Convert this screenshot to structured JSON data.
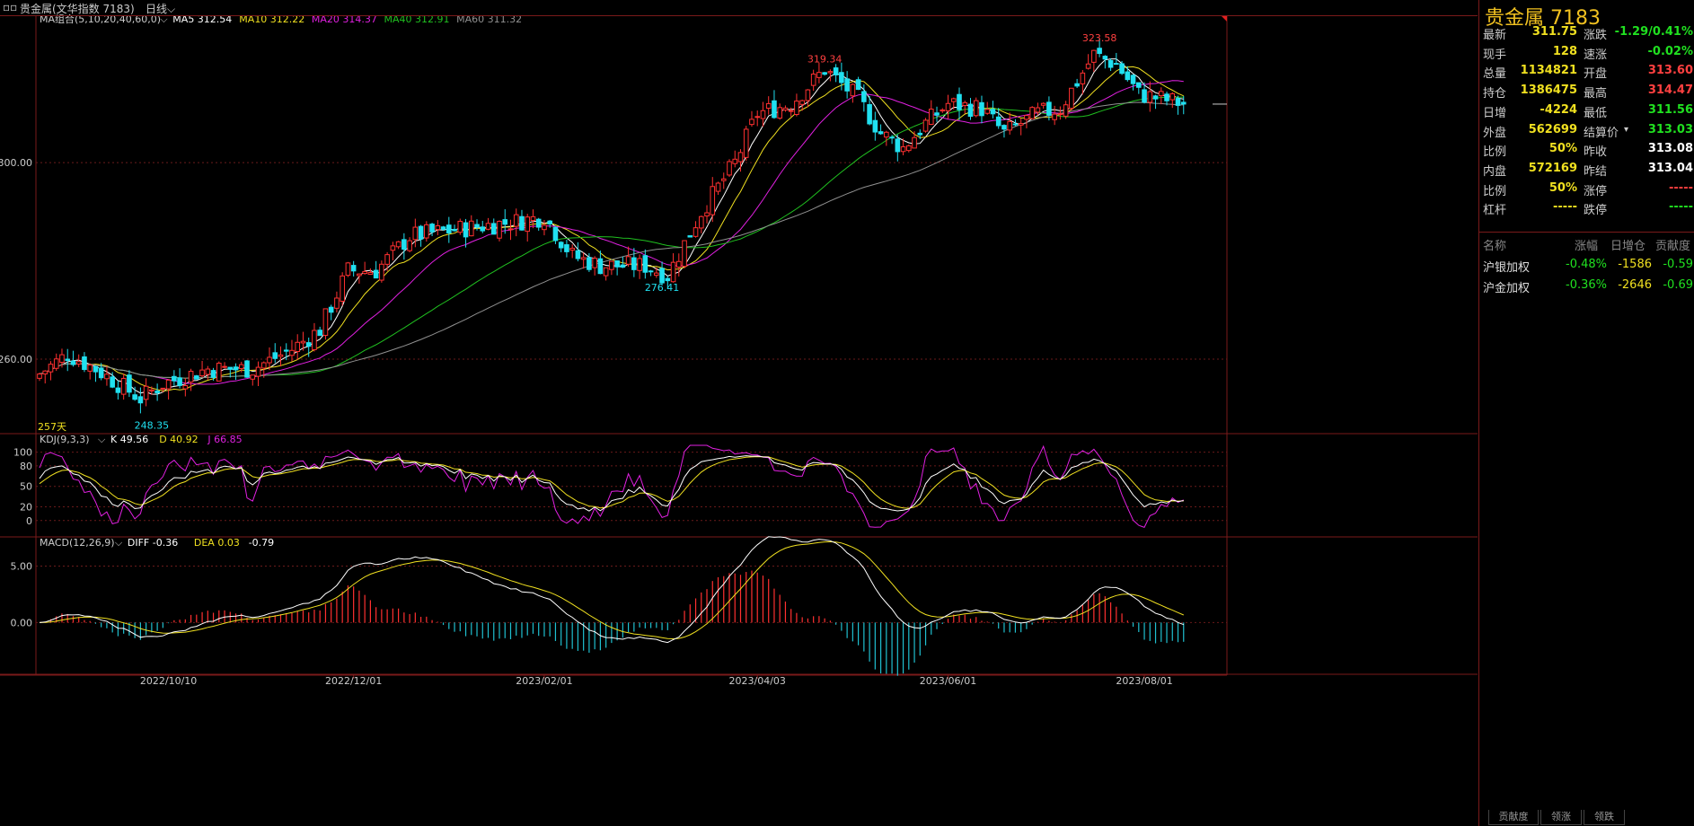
{
  "titlebar": {
    "name": "贵金属(文华指数 7183)",
    "period": "日线"
  },
  "indicators": {
    "ma": {
      "label": "MA组合(5,10,20,40,60,0)",
      "items": [
        {
          "text": "MA5 312.54",
          "color": "#ffffff"
        },
        {
          "text": "MA10 312.22",
          "color": "#f0e020"
        },
        {
          "text": "MA20 314.37",
          "color": "#e020e0"
        },
        {
          "text": "MA40 312.91",
          "color": "#20c020"
        },
        {
          "text": "MA60 311.32",
          "color": "#909090"
        }
      ]
    },
    "kdj": {
      "label": "KDJ(9,3,3)",
      "items": [
        {
          "text": "K 49.56",
          "color": "#ffffff"
        },
        {
          "text": "D 40.92",
          "color": "#f0e020"
        },
        {
          "text": "J 66.85",
          "color": "#e020e0"
        }
      ]
    },
    "macd": {
      "label": "MACD(12,26,9)",
      "items": [
        {
          "text": "DIFF -0.36",
          "color": "#ffffff"
        },
        {
          "text": "DEA 0.03",
          "color": "#f0e020"
        },
        {
          "text": "-0.79",
          "color": "#ffffff"
        }
      ]
    }
  },
  "chart_data": {
    "type": "candlestick",
    "ylim": [
      245,
      330
    ],
    "yticks": [
      {
        "value": 300,
        "label": "300.00"
      },
      {
        "value": 260,
        "label": "260.00"
      }
    ],
    "kdj_ticks": [
      {
        "value": 100,
        "label": "100"
      },
      {
        "value": 80,
        "label": "80"
      },
      {
        "value": 50,
        "label": "50"
      },
      {
        "value": 20,
        "label": "20"
      },
      {
        "value": 0,
        "label": "0"
      }
    ],
    "macd_ticks": [
      {
        "value": 5,
        "label": "5.00"
      },
      {
        "value": 0,
        "label": "0.00"
      }
    ],
    "macd_range": [
      -4.5,
      7.5
    ],
    "x_labels": [
      {
        "index": 23,
        "label": "2022/10/10"
      },
      {
        "index": 56,
        "label": "2022/12/01"
      },
      {
        "index": 90,
        "label": "2023/02/01"
      },
      {
        "index": 128,
        "label": "2023/04/03"
      },
      {
        "index": 162,
        "label": "2023/06/01"
      },
      {
        "index": 197,
        "label": "2023/08/01"
      }
    ],
    "annotations": [
      {
        "text": "323.58",
        "index": 189,
        "value": 323.58,
        "color": "#ff4040",
        "pos": "above"
      },
      {
        "text": "319.34",
        "index": 140,
        "value": 319.34,
        "color": "#ff4040",
        "pos": "above"
      },
      {
        "text": "276.41",
        "index": 111,
        "value": 276.41,
        "color": "#20e0f0",
        "pos": "below"
      },
      {
        "text": "248.35",
        "index": 20,
        "value": 248.35,
        "color": "#20e0f0",
        "pos": "below"
      }
    ],
    "days_label": "257天",
    "key_points": [
      [
        0,
        257
      ],
      [
        5,
        261
      ],
      [
        10,
        258
      ],
      [
        18,
        252
      ],
      [
        22,
        255
      ],
      [
        30,
        258
      ],
      [
        38,
        258
      ],
      [
        45,
        262
      ],
      [
        50,
        266
      ],
      [
        55,
        278
      ],
      [
        60,
        278
      ],
      [
        66,
        285
      ],
      [
        72,
        286
      ],
      [
        78,
        287
      ],
      [
        85,
        288
      ],
      [
        90,
        289
      ],
      [
        95,
        281
      ],
      [
        100,
        279
      ],
      [
        108,
        279
      ],
      [
        112,
        277
      ],
      [
        118,
        290
      ],
      [
        124,
        300
      ],
      [
        128,
        310
      ],
      [
        134,
        312
      ],
      [
        140,
        319
      ],
      [
        146,
        313
      ],
      [
        150,
        306
      ],
      [
        154,
        303
      ],
      [
        158,
        308
      ],
      [
        162,
        312
      ],
      [
        168,
        311
      ],
      [
        172,
        306
      ],
      [
        178,
        310
      ],
      [
        182,
        311
      ],
      [
        188,
        322
      ],
      [
        192,
        320
      ],
      [
        196,
        314
      ],
      [
        200,
        313
      ],
      [
        204,
        312
      ]
    ],
    "ma_series": [
      {
        "name": "MA5",
        "period": 5,
        "color": "#ffffff"
      },
      {
        "name": "MA10",
        "period": 10,
        "color": "#f0e020"
      },
      {
        "name": "MA20",
        "period": 20,
        "color": "#e020e0"
      },
      {
        "name": "MA40",
        "period": 40,
        "color": "#20c020"
      },
      {
        "name": "MA60",
        "period": 60,
        "color": "#909090"
      }
    ]
  },
  "quote": {
    "title": "贵金属  7183",
    "rows": [
      {
        "l": "最新",
        "v": "311.75",
        "vc": "#f0e020",
        "l2": "涨跌",
        "v2": "-1.29/0.41%",
        "v2c": "#20e020"
      },
      {
        "l": "现手",
        "v": "128",
        "vc": "#f0e020",
        "l2": "速涨",
        "v2": "-0.02%",
        "v2c": "#20e020"
      },
      {
        "l": "总量",
        "v": "1134821",
        "vc": "#f0e020",
        "l2": "开盘",
        "v2": "313.60",
        "v2c": "#ff4040"
      },
      {
        "l": "持仓",
        "v": "1386475",
        "vc": "#f0e020",
        "l2": "最高",
        "v2": "314.47",
        "v2c": "#ff4040"
      },
      {
        "l": "日增",
        "v": "-4224",
        "vc": "#f0e020",
        "l2": "最低",
        "v2": "311.56",
        "v2c": "#20e020"
      },
      {
        "l": "外盘",
        "v": "562699",
        "vc": "#f0e020",
        "l2": "结算价",
        "v2": "313.03",
        "v2c": "#20e020"
      },
      {
        "l": "比例",
        "v": "50%",
        "vc": "#f0e020",
        "l2": "昨收",
        "v2": "313.08",
        "v2c": "#ffffff"
      },
      {
        "l": "内盘",
        "v": "572169",
        "vc": "#f0e020",
        "l2": "昨结",
        "v2": "313.04",
        "v2c": "#ffffff"
      },
      {
        "l": "比例",
        "v": "50%",
        "vc": "#f0e020",
        "l2": "涨停",
        "v2": "-----",
        "v2c": "#ff4040"
      },
      {
        "l": "杠杆",
        "v": "-----",
        "vc": "#f0e020",
        "l2": "跌停",
        "v2": "-----",
        "v2c": "#20e020"
      }
    ],
    "components_header": [
      "名称",
      "涨幅",
      "日增仓",
      "贡献度"
    ],
    "components": [
      {
        "name": "沪银加权",
        "change": "-0.48%",
        "inc": "-1586",
        "contrib": "-0.59"
      },
      {
        "name": "沪金加权",
        "change": "-0.36%",
        "inc": "-2646",
        "contrib": "-0.69"
      }
    ]
  },
  "bottom_tabs": [
    "贡献度",
    "领涨",
    "领跌"
  ]
}
